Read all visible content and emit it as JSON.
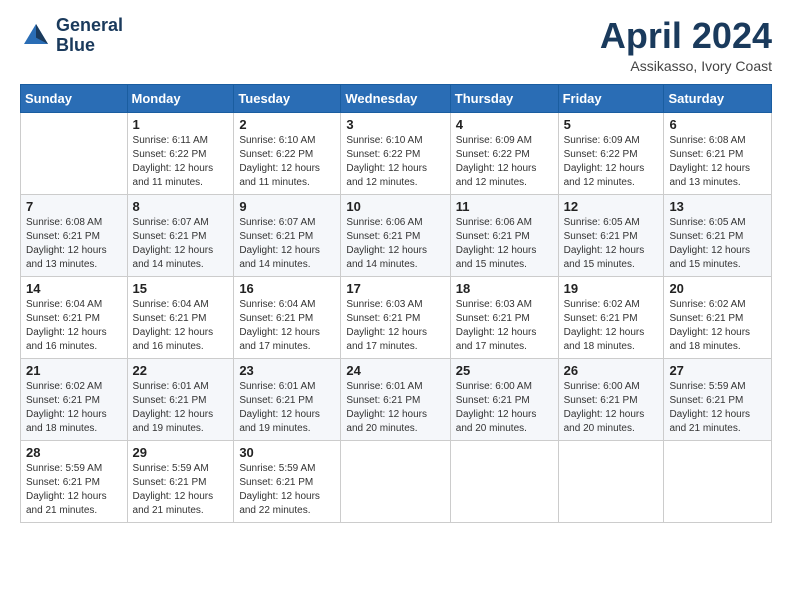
{
  "header": {
    "logo_line1": "General",
    "logo_line2": "Blue",
    "month_title": "April 2024",
    "location": "Assikasso, Ivory Coast"
  },
  "days_of_week": [
    "Sunday",
    "Monday",
    "Tuesday",
    "Wednesday",
    "Thursday",
    "Friday",
    "Saturday"
  ],
  "weeks": [
    [
      {
        "day": "",
        "info": ""
      },
      {
        "day": "1",
        "info": "Sunrise: 6:11 AM\nSunset: 6:22 PM\nDaylight: 12 hours\nand 11 minutes."
      },
      {
        "day": "2",
        "info": "Sunrise: 6:10 AM\nSunset: 6:22 PM\nDaylight: 12 hours\nand 11 minutes."
      },
      {
        "day": "3",
        "info": "Sunrise: 6:10 AM\nSunset: 6:22 PM\nDaylight: 12 hours\nand 12 minutes."
      },
      {
        "day": "4",
        "info": "Sunrise: 6:09 AM\nSunset: 6:22 PM\nDaylight: 12 hours\nand 12 minutes."
      },
      {
        "day": "5",
        "info": "Sunrise: 6:09 AM\nSunset: 6:22 PM\nDaylight: 12 hours\nand 12 minutes."
      },
      {
        "day": "6",
        "info": "Sunrise: 6:08 AM\nSunset: 6:21 PM\nDaylight: 12 hours\nand 13 minutes."
      }
    ],
    [
      {
        "day": "7",
        "info": "Sunrise: 6:08 AM\nSunset: 6:21 PM\nDaylight: 12 hours\nand 13 minutes."
      },
      {
        "day": "8",
        "info": "Sunrise: 6:07 AM\nSunset: 6:21 PM\nDaylight: 12 hours\nand 14 minutes."
      },
      {
        "day": "9",
        "info": "Sunrise: 6:07 AM\nSunset: 6:21 PM\nDaylight: 12 hours\nand 14 minutes."
      },
      {
        "day": "10",
        "info": "Sunrise: 6:06 AM\nSunset: 6:21 PM\nDaylight: 12 hours\nand 14 minutes."
      },
      {
        "day": "11",
        "info": "Sunrise: 6:06 AM\nSunset: 6:21 PM\nDaylight: 12 hours\nand 15 minutes."
      },
      {
        "day": "12",
        "info": "Sunrise: 6:05 AM\nSunset: 6:21 PM\nDaylight: 12 hours\nand 15 minutes."
      },
      {
        "day": "13",
        "info": "Sunrise: 6:05 AM\nSunset: 6:21 PM\nDaylight: 12 hours\nand 15 minutes."
      }
    ],
    [
      {
        "day": "14",
        "info": "Sunrise: 6:04 AM\nSunset: 6:21 PM\nDaylight: 12 hours\nand 16 minutes."
      },
      {
        "day": "15",
        "info": "Sunrise: 6:04 AM\nSunset: 6:21 PM\nDaylight: 12 hours\nand 16 minutes."
      },
      {
        "day": "16",
        "info": "Sunrise: 6:04 AM\nSunset: 6:21 PM\nDaylight: 12 hours\nand 17 minutes."
      },
      {
        "day": "17",
        "info": "Sunrise: 6:03 AM\nSunset: 6:21 PM\nDaylight: 12 hours\nand 17 minutes."
      },
      {
        "day": "18",
        "info": "Sunrise: 6:03 AM\nSunset: 6:21 PM\nDaylight: 12 hours\nand 17 minutes."
      },
      {
        "day": "19",
        "info": "Sunrise: 6:02 AM\nSunset: 6:21 PM\nDaylight: 12 hours\nand 18 minutes."
      },
      {
        "day": "20",
        "info": "Sunrise: 6:02 AM\nSunset: 6:21 PM\nDaylight: 12 hours\nand 18 minutes."
      }
    ],
    [
      {
        "day": "21",
        "info": "Sunrise: 6:02 AM\nSunset: 6:21 PM\nDaylight: 12 hours\nand 18 minutes."
      },
      {
        "day": "22",
        "info": "Sunrise: 6:01 AM\nSunset: 6:21 PM\nDaylight: 12 hours\nand 19 minutes."
      },
      {
        "day": "23",
        "info": "Sunrise: 6:01 AM\nSunset: 6:21 PM\nDaylight: 12 hours\nand 19 minutes."
      },
      {
        "day": "24",
        "info": "Sunrise: 6:01 AM\nSunset: 6:21 PM\nDaylight: 12 hours\nand 20 minutes."
      },
      {
        "day": "25",
        "info": "Sunrise: 6:00 AM\nSunset: 6:21 PM\nDaylight: 12 hours\nand 20 minutes."
      },
      {
        "day": "26",
        "info": "Sunrise: 6:00 AM\nSunset: 6:21 PM\nDaylight: 12 hours\nand 20 minutes."
      },
      {
        "day": "27",
        "info": "Sunrise: 5:59 AM\nSunset: 6:21 PM\nDaylight: 12 hours\nand 21 minutes."
      }
    ],
    [
      {
        "day": "28",
        "info": "Sunrise: 5:59 AM\nSunset: 6:21 PM\nDaylight: 12 hours\nand 21 minutes."
      },
      {
        "day": "29",
        "info": "Sunrise: 5:59 AM\nSunset: 6:21 PM\nDaylight: 12 hours\nand 21 minutes."
      },
      {
        "day": "30",
        "info": "Sunrise: 5:59 AM\nSunset: 6:21 PM\nDaylight: 12 hours\nand 22 minutes."
      },
      {
        "day": "",
        "info": ""
      },
      {
        "day": "",
        "info": ""
      },
      {
        "day": "",
        "info": ""
      },
      {
        "day": "",
        "info": ""
      }
    ]
  ]
}
